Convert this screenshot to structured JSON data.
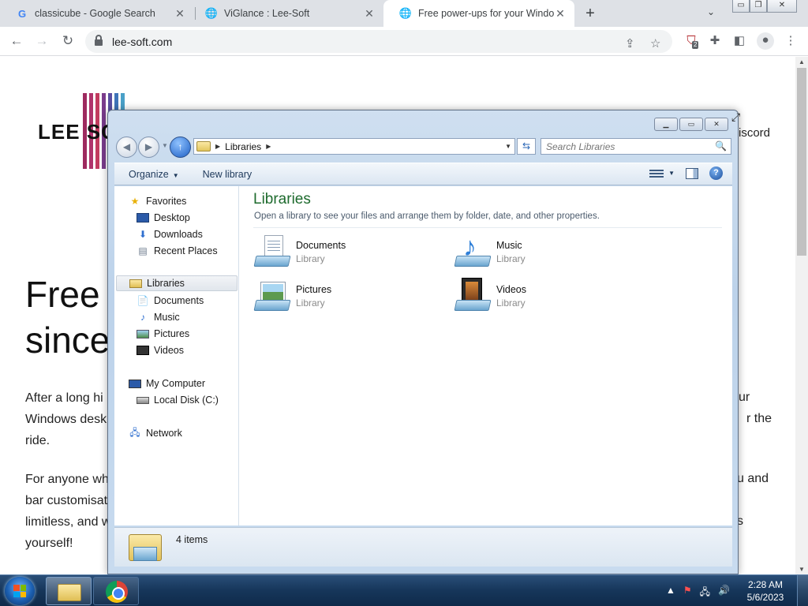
{
  "browser": {
    "tabs": [
      {
        "title": "classicube - Google Search",
        "icon": "google-icon"
      },
      {
        "title": "ViGlance : Lee-Soft",
        "icon": "globe-icon"
      },
      {
        "title": "Free power-ups for your Window",
        "icon": "globe-icon",
        "active": true
      }
    ],
    "url": "lee-soft.com",
    "extension_badge": "2"
  },
  "website": {
    "logo_text": "LEE SO",
    "nav_right": "iscord",
    "hero_line1": "Free",
    "hero_line2": "since",
    "p1_line1": "After a long hi",
    "p1_line2": "Windows desk",
    "p1_line3": "ride.",
    "p1_right1": "ur",
    "p1_right2": "r the",
    "p2_line1": "For anyone wh",
    "p2_line2": "bar customisat",
    "p2_line3": "limitless, and w",
    "p2_line4": "yourself!",
    "p2_right1": "u and",
    "p2_right3": "s",
    "logo_colors": [
      "#9e2a5f",
      "#b0336b",
      "#c23b5f",
      "#7a3c8c",
      "#5a4ea0",
      "#3f74b8",
      "#4aa0c8"
    ]
  },
  "explorer": {
    "address_crumb": "Libraries",
    "search_placeholder": "Search Libraries",
    "commands": {
      "organize": "Organize",
      "new_library": "New library"
    },
    "nav": {
      "favorites": "Favorites",
      "desktop": "Desktop",
      "downloads": "Downloads",
      "recent_places": "Recent Places",
      "libraries": "Libraries",
      "documents": "Documents",
      "music": "Music",
      "pictures": "Pictures",
      "videos": "Videos",
      "my_computer": "My Computer",
      "local_disk": "Local Disk (C:)",
      "network": "Network"
    },
    "content_title": "Libraries",
    "content_subtitle": "Open a library to see your files and arrange them by folder, date, and other properties.",
    "libraries": [
      {
        "name": "Documents",
        "type": "Library",
        "icon": "documents-library-icon"
      },
      {
        "name": "Music",
        "type": "Library",
        "icon": "music-library-icon"
      },
      {
        "name": "Pictures",
        "type": "Library",
        "icon": "pictures-library-icon"
      },
      {
        "name": "Videos",
        "type": "Library",
        "icon": "videos-library-icon"
      }
    ],
    "status_count": "4 items"
  },
  "taskbar": {
    "time": "2:28 AM",
    "date": "5/6/2023"
  }
}
